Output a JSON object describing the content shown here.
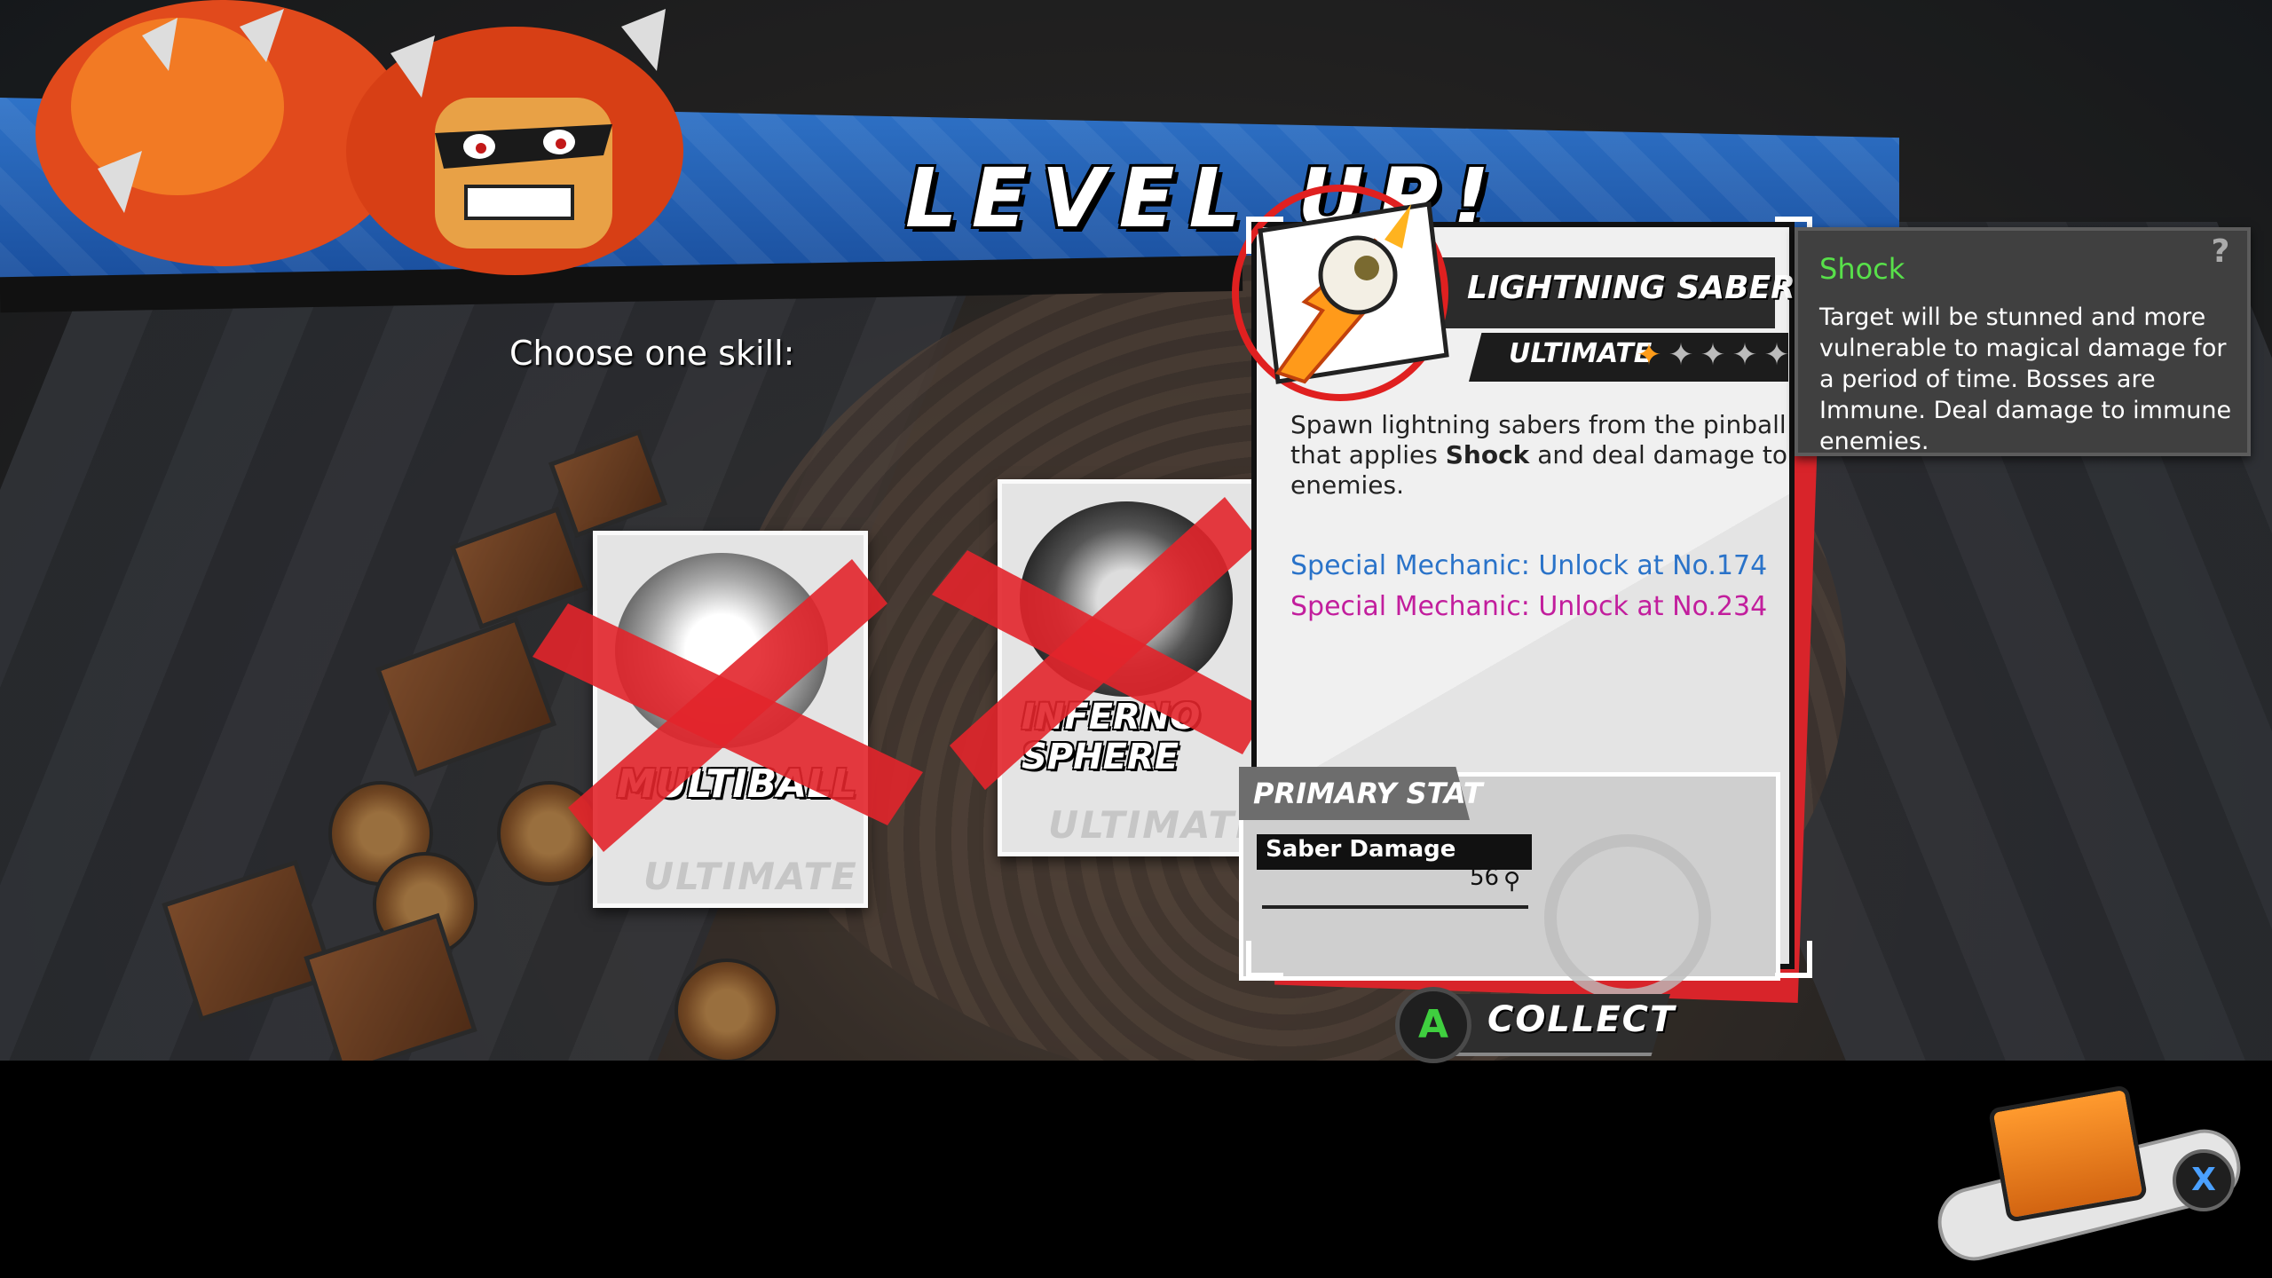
{
  "screen": {
    "title": "LEVEL UP!",
    "prompt": "Choose one skill:"
  },
  "choices": [
    {
      "name": "MULTIBALL",
      "rank": "ULTIMATE",
      "state": "crossed-out"
    },
    {
      "name_line1": "INFERNO",
      "name_line2": "SPHERE",
      "rank": "ULTIMATE",
      "state": "crossed-out"
    }
  ],
  "selected": {
    "name": "LIGHTNING SABER",
    "rank": "ULTIMATE",
    "stars_total": 5,
    "stars_lit": 1,
    "description_pre": "Spawn lightning sabers from the pinball that applies ",
    "description_keyword": "Shock",
    "description_post": " and deal damage to enemies.",
    "mechanic_1": "Special Mechanic: Unlock at No.174",
    "mechanic_2": "Special Mechanic: Unlock at No.234",
    "primary_stat_title": "PRIMARY STAT",
    "stat_label": "Saber Damage",
    "stat_value": "56"
  },
  "tooltip": {
    "title": "Shock",
    "text": "Target will be stunned and more vulnerable to magical damage for a period of time. Bosses are Immune. Deal damage to immune enemies.",
    "help": "?"
  },
  "actions": {
    "collect_button": "A",
    "collect_label": "COLLECT",
    "inventory_button": "X"
  },
  "colors": {
    "banner": "#2f73c8",
    "accent_red": "#d8242a",
    "mechanic_blue": "#2a73c9",
    "mechanic_magenta": "#c21e9d",
    "tooltip_title": "#58e04a",
    "star_lit": "#ff9d1a"
  },
  "icons": [
    "boss-portrait-icon",
    "lightning-saber-icon",
    "multiball-icon",
    "inferno-sphere-icon",
    "saber-stat-icon",
    "inventory-bag-icon",
    "help-icon"
  ]
}
